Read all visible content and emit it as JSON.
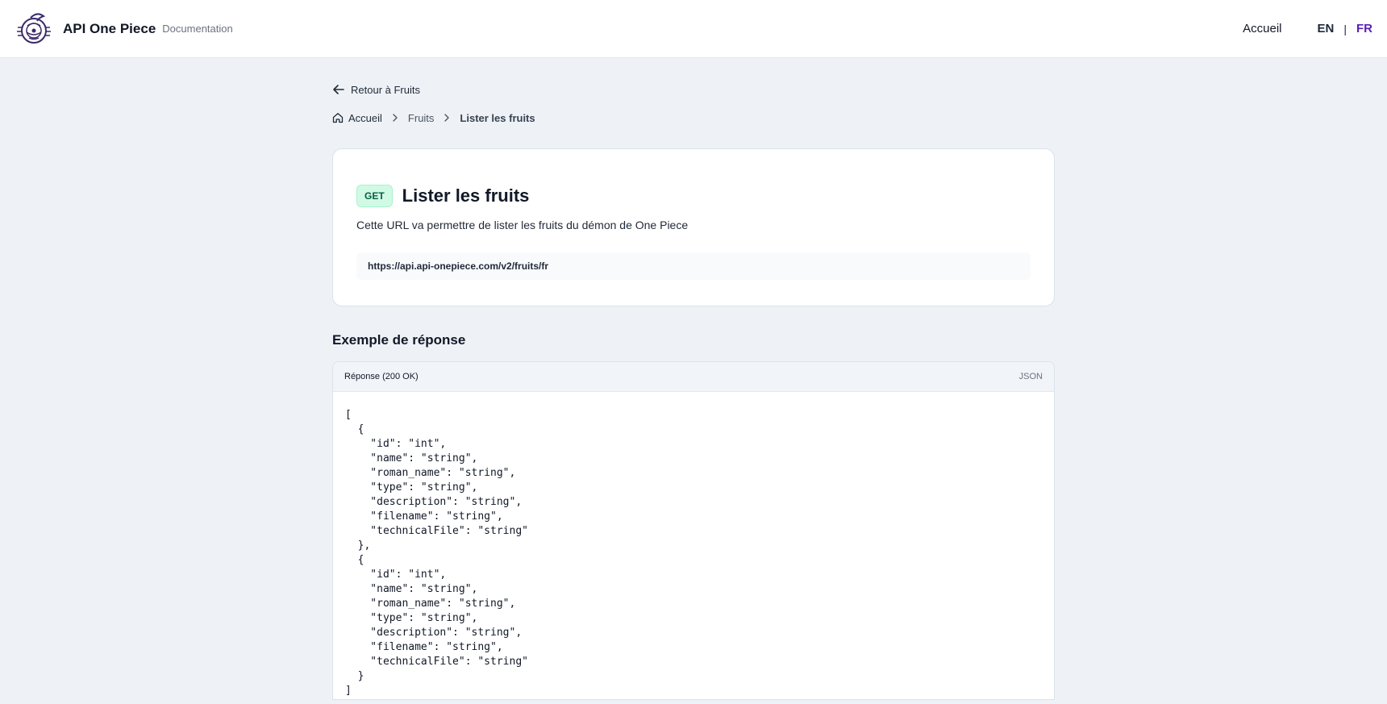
{
  "header": {
    "brand_title": "API One Piece",
    "brand_subtitle": "Documentation",
    "nav_home": "Accueil",
    "lang_en": "EN",
    "lang_sep": "|",
    "lang_fr": "FR"
  },
  "back_link": "Retour à Fruits",
  "breadcrumb": {
    "home": "Accueil",
    "section": "Fruits",
    "current": "Lister les fruits"
  },
  "endpoint": {
    "method": "GET",
    "title": "Lister les fruits",
    "description": "Cette URL va permettre de lister les fruits du démon de One Piece",
    "url": "https://api.api-onepiece.com/v2/fruits/fr"
  },
  "response": {
    "section_title": "Exemple de réponse",
    "status": "Réponse (200 OK)",
    "format": "JSON",
    "body": "[\n  {\n    \"id\": \"int\",\n    \"name\": \"string\",\n    \"roman_name\": \"string\",\n    \"type\": \"string\",\n    \"description\": \"string\",\n    \"filename\": \"string\",\n    \"technicalFile\": \"string\"\n  },\n  {\n    \"id\": \"int\",\n    \"name\": \"string\",\n    \"roman_name\": \"string\",\n    \"type\": \"string\",\n    \"description\": \"string\",\n    \"filename\": \"string\",\n    \"technicalFile\": \"string\"\n  }\n]"
  },
  "colors": {
    "accent": "#5b21b6",
    "get_badge_bg": "#d1fae5",
    "get_badge_text": "#065f46",
    "page_bg": "#eef2f6"
  }
}
